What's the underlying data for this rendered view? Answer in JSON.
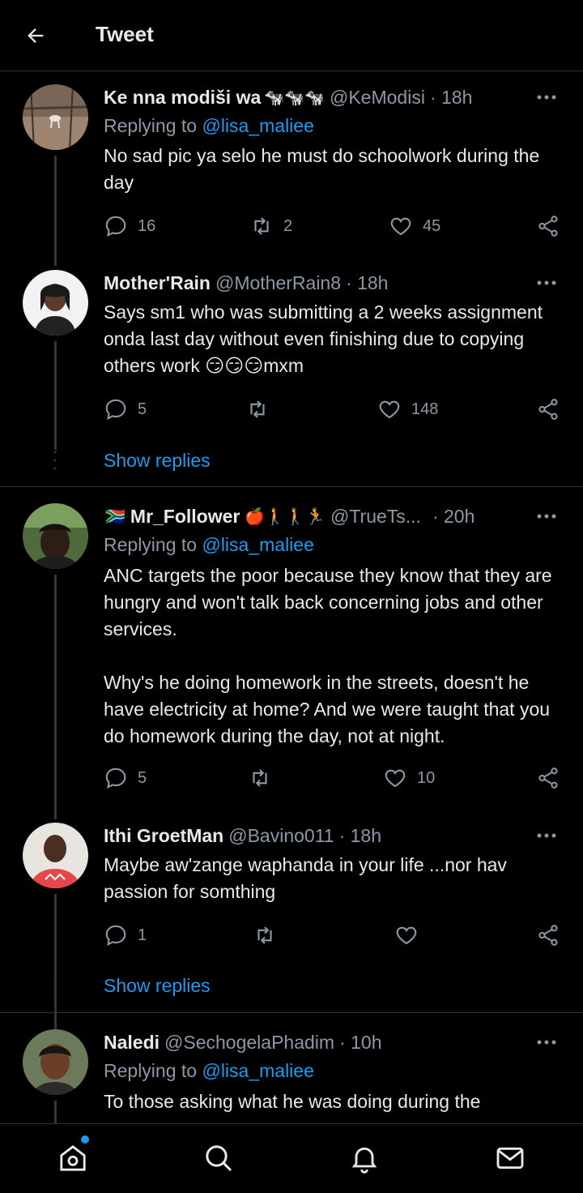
{
  "header": {
    "title": "Tweet"
  },
  "show_replies_label": "Show replies",
  "tweets": [
    {
      "name": "Ke nna modiši wa",
      "name_emoji": "🐄🐄🐄",
      "handle": "@KeModisi",
      "time": "· 18h",
      "replying_prefix": "Replying to",
      "replying_to": "@lisa_maliee",
      "text": "No sad pic  ya selo he must do schoolwork during the day",
      "replies": "16",
      "retweets": "2",
      "likes": "45"
    },
    {
      "name": "Mother'Rain",
      "handle": "@MotherRain8",
      "time": "· 18h",
      "text": "Says sm1 who was submitting a 2 weeks assignment onda last day without even finishing due to copying others work 😏😏😏mxm",
      "replies": "5",
      "retweets": "",
      "likes": "148"
    },
    {
      "flag": "🇿🇦",
      "name": "Mr_Follower",
      "name_emoji": "🍎🚶🚶🏃",
      "handle": "@TrueTs...",
      "time": "· 20h",
      "replying_prefix": "Replying to",
      "replying_to": "@lisa_maliee",
      "text": "ANC targets the poor because they know that they are hungry and won't talk back concerning jobs and other services.\n\nWhy's he doing homework in the streets, doesn't he have electricity at home? And we were taught that you do homework during the day, not at night.",
      "replies": "5",
      "retweets": "",
      "likes": "10"
    },
    {
      "name": "Ithi GroetMan",
      "handle": "@Bavino011",
      "time": "· 18h",
      "text": "Maybe aw'zange waphanda in your life ...nor hav passion for somthing",
      "replies": "1",
      "retweets": "",
      "likes": ""
    },
    {
      "name": "Naledi",
      "handle": "@SechogelaPhadim",
      "time": "· 10h",
      "replying_prefix": "Replying to",
      "replying_to": "@lisa_maliee",
      "text": "To those asking what he was doing during the"
    }
  ],
  "icons": {
    "back": "arrow-left-icon",
    "more": "more-horizontal-icon",
    "reply": "reply-bubble-icon",
    "retweet": "retweet-icon",
    "like": "heart-icon",
    "share": "share-icon",
    "home": "home-icon",
    "search": "search-icon",
    "notifications": "bell-icon",
    "messages": "mail-icon"
  },
  "colors": {
    "background": "#000000",
    "text": "#e7e9ea",
    "secondary": "#8b98a5",
    "accent": "#1d9bf0",
    "border": "#2f3336"
  }
}
